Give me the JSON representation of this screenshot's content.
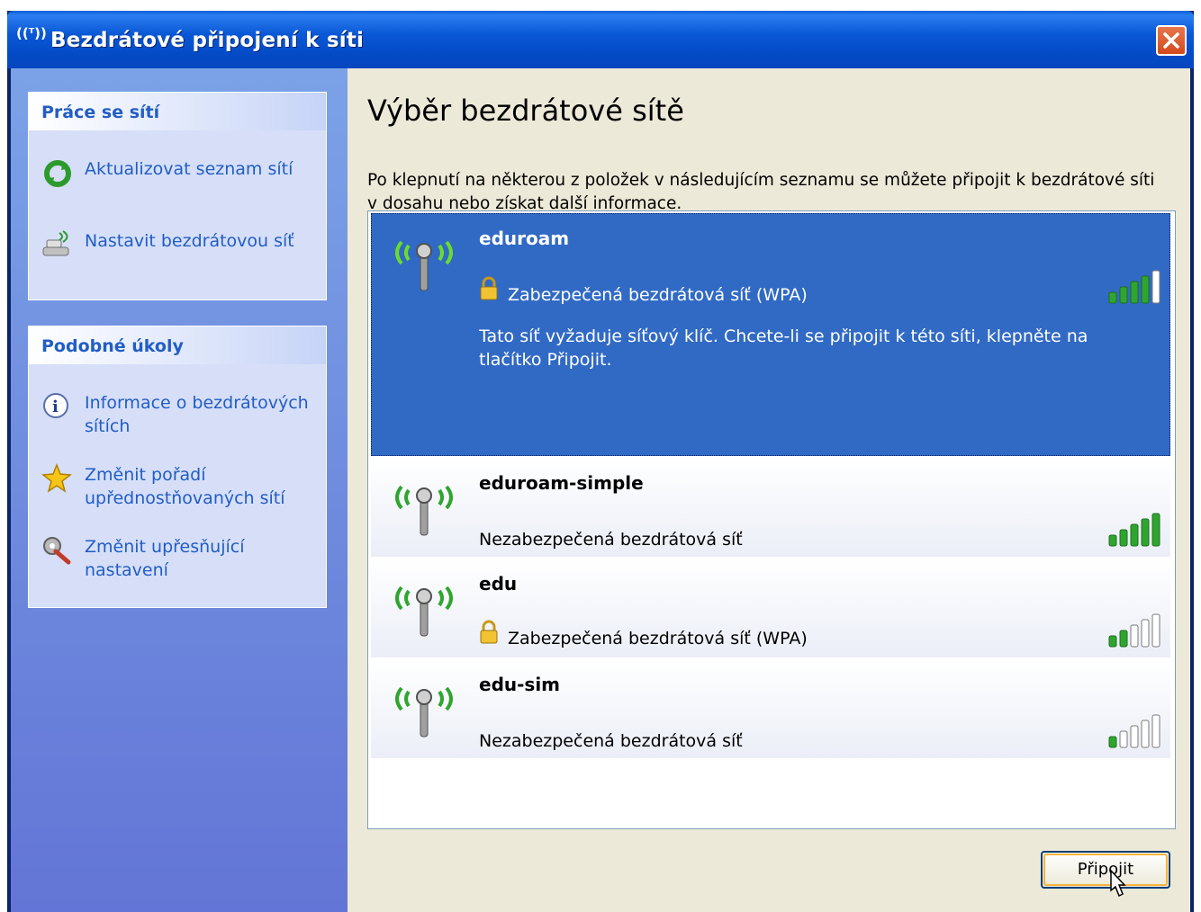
{
  "window": {
    "title": "Bezdrátové připojení k síti",
    "title_icon": "((ᵀ))",
    "close_icon": "close-icon"
  },
  "sidebar": {
    "panels": [
      {
        "title": "Práce se sítí",
        "items": [
          {
            "label": "Aktualizovat seznam sítí",
            "icon": "refresh-icon"
          },
          {
            "label": "Nastavit bezdrátovou síť",
            "icon": "wireless-setup-icon"
          }
        ]
      },
      {
        "title": "Podobné úkoly",
        "items": [
          {
            "label": "Informace o bezdrátových sítích",
            "icon": "info-icon"
          },
          {
            "label": "Změnit pořadí upřednostňovaných sítí",
            "icon": "star-icon"
          },
          {
            "label": "Změnit upřesňující nastavení",
            "icon": "settings-icon"
          }
        ]
      }
    ]
  },
  "main": {
    "heading": "Výběr bezdrátové sítě",
    "intro": "Po klepnutí na některou z položek v následujícím seznamu se můžete připojit k bezdrátové síti v dosahu nebo získat další informace.",
    "networks": [
      {
        "ssid": "eduroam",
        "security": "Zabezpečená bezdrátová síť (WPA)",
        "secured": true,
        "selected": true,
        "signal_bars": 4,
        "description": "Tato síť vyžaduje síťový klíč. Chcete-li se připojit k této síti, klepněte na tlačítko Připojit."
      },
      {
        "ssid": "eduroam-simple",
        "security": "Nezabezpečená bezdrátová síť",
        "secured": false,
        "selected": false,
        "signal_bars": 5
      },
      {
        "ssid": "edu",
        "security": "Zabezpečená bezdrátová síť (WPA)",
        "secured": true,
        "selected": false,
        "signal_bars": 2
      },
      {
        "ssid": "edu-sim",
        "security": "Nezabezpečená bezdrátová síť",
        "secured": false,
        "selected": false,
        "signal_bars": 1
      }
    ],
    "connect_label": "Připojit"
  },
  "colors": {
    "title_blue": "#0a58d6",
    "link_blue": "#215dc6",
    "selection": "#316ac5",
    "signal_on": "#2fa52f",
    "button_focus": "#f8b33b"
  }
}
